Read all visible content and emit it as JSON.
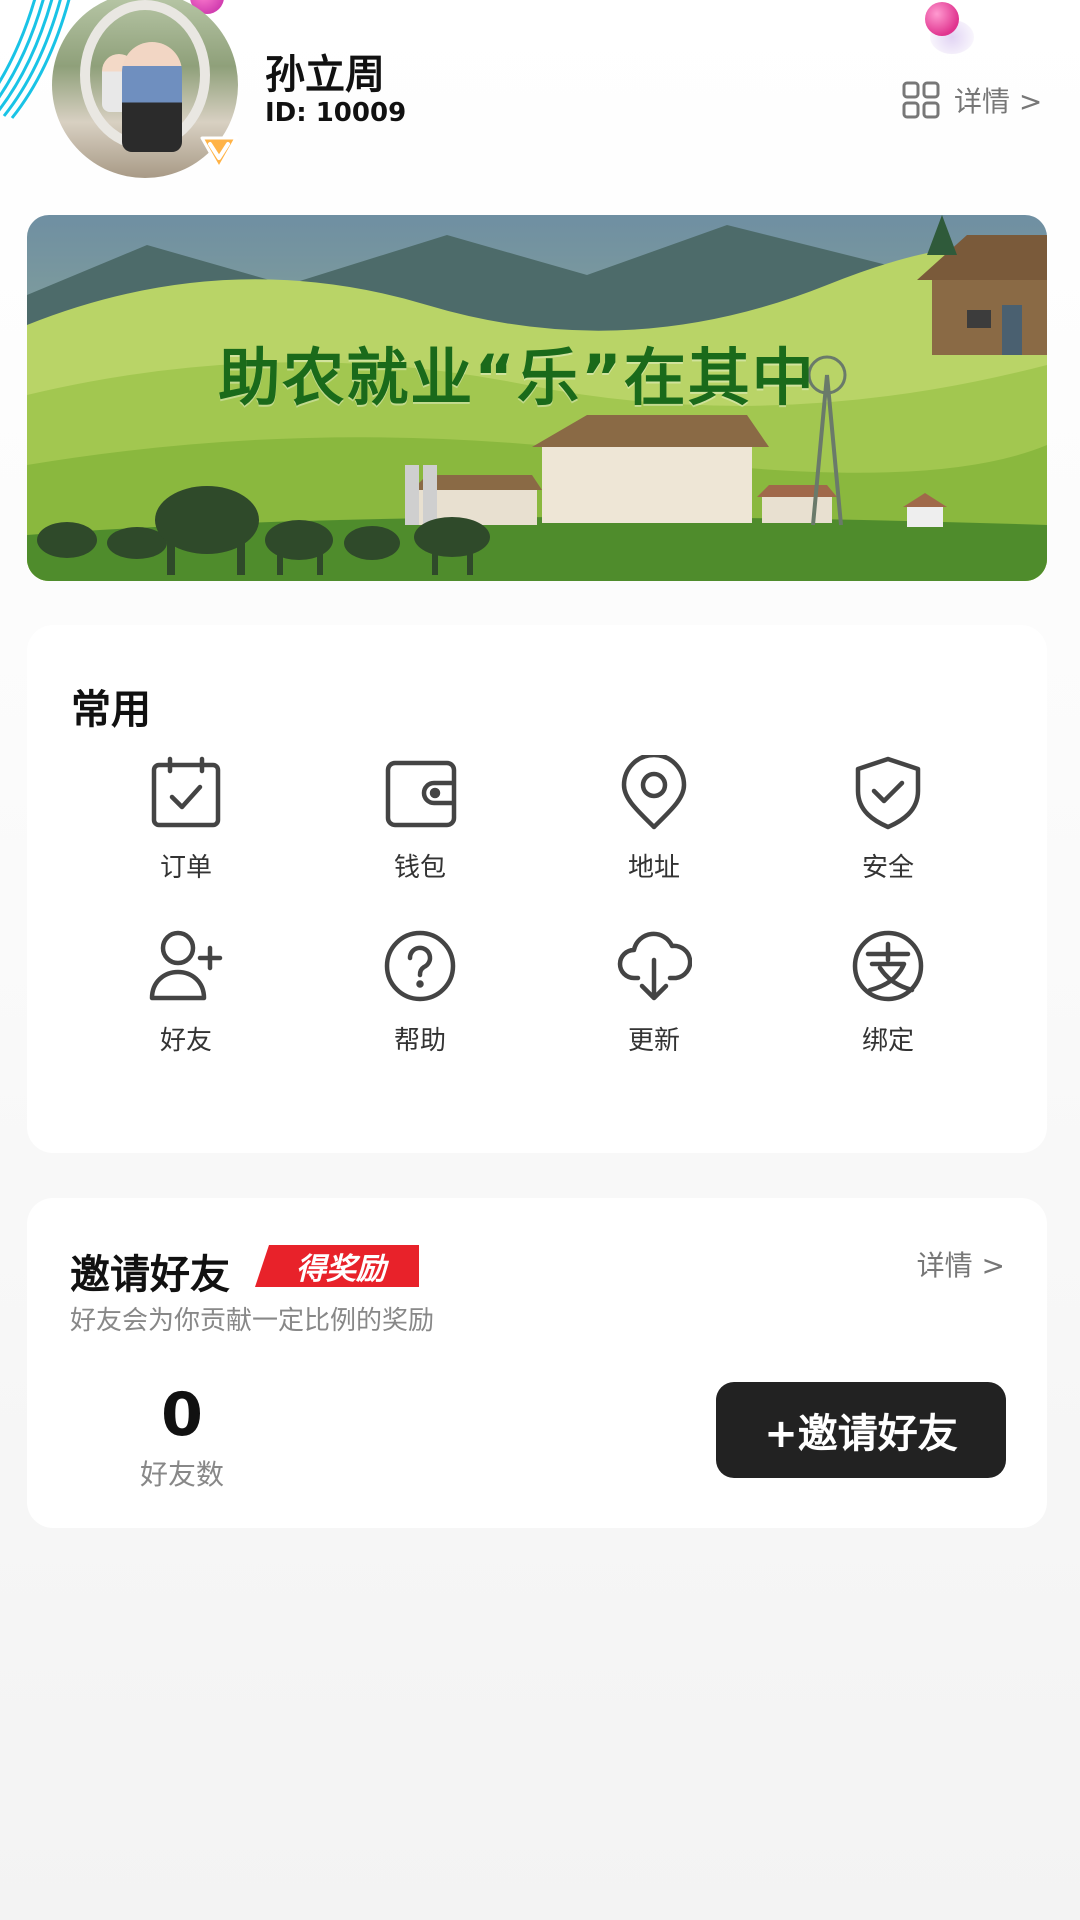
{
  "user": {
    "name": "孙立周",
    "id_text": "ID: 10009"
  },
  "header": {
    "detail_label": "详情 >"
  },
  "banner": {
    "title": "助农就业“乐”在其中"
  },
  "common": {
    "title": "常用",
    "items": [
      {
        "label": "订单",
        "icon": "calendar-check-icon"
      },
      {
        "label": "钱包",
        "icon": "wallet-icon"
      },
      {
        "label": "地址",
        "icon": "location-pin-icon"
      },
      {
        "label": "安全",
        "icon": "shield-check-icon"
      },
      {
        "label": "好友",
        "icon": "user-add-icon"
      },
      {
        "label": "帮助",
        "icon": "help-circle-icon"
      },
      {
        "label": "更新",
        "icon": "cloud-download-icon"
      },
      {
        "label": "绑定",
        "icon": "alipay-icon"
      }
    ]
  },
  "invite": {
    "title": "邀请好友",
    "reward_tag": "得奖励",
    "subtitle": "好友会为你贡献一定比例的奖励",
    "detail_label": "详情 >",
    "friend_count": "0",
    "friend_count_label": "好友数",
    "button_label": "+邀请好友"
  },
  "colors": {
    "accent_dark": "#222222",
    "reward_red": "#e8222a",
    "banner_green": "#1a6a1a"
  }
}
